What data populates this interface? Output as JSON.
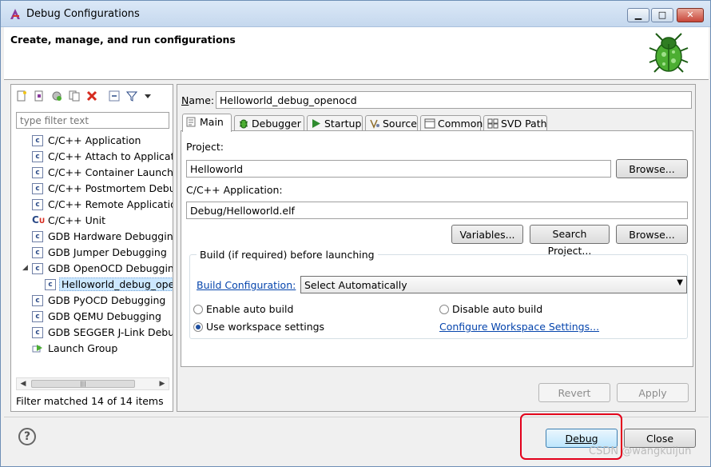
{
  "window": {
    "title": "Debug Configurations",
    "controls": {
      "minimize": "▁",
      "maximize": "□",
      "close": "✕"
    }
  },
  "banner": {
    "headline": "Create, manage, and run configurations"
  },
  "left_panel": {
    "filter_placeholder": "type filter text",
    "tree": [
      {
        "label": "C/C++ Application",
        "icon": "c-config-icon",
        "level": 1
      },
      {
        "label": "C/C++ Attach to Applicatio",
        "icon": "c-config-icon",
        "level": 1
      },
      {
        "label": "C/C++ Container Launche",
        "icon": "c-config-icon",
        "level": 1
      },
      {
        "label": "C/C++ Postmortem Debu",
        "icon": "c-config-icon",
        "level": 1
      },
      {
        "label": "C/C++ Remote Applicatio",
        "icon": "c-config-icon",
        "level": 1
      },
      {
        "label": "C/C++ Unit",
        "icon": "cu-icon",
        "level": 1
      },
      {
        "label": "GDB Hardware Debugging",
        "icon": "c-config-icon",
        "level": 1
      },
      {
        "label": "GDB Jumper Debugging",
        "icon": "c-config-icon",
        "level": 1
      },
      {
        "label": "GDB OpenOCD Debuggin",
        "icon": "c-config-icon",
        "level": 1,
        "expanded": true
      },
      {
        "label": "Helloworld_debug_ope",
        "icon": "c-config-icon",
        "level": 2,
        "selected": true
      },
      {
        "label": "GDB PyOCD Debugging",
        "icon": "c-config-icon",
        "level": 1
      },
      {
        "label": "GDB QEMU Debugging",
        "icon": "c-config-icon",
        "level": 1
      },
      {
        "label": "GDB SEGGER J-Link Debu",
        "icon": "c-config-icon",
        "level": 1
      },
      {
        "label": "Launch Group",
        "icon": "launch-group-icon",
        "level": 1
      }
    ],
    "filter_status": "Filter matched 14 of 14 items"
  },
  "main": {
    "name_label": "Name:",
    "name_value": "Helloworld_debug_openocd",
    "tabs": [
      {
        "label": "Main",
        "icon": "main-tab-icon",
        "active": true
      },
      {
        "label": "Debugger",
        "icon": "bug-icon"
      },
      {
        "label": "Startup",
        "icon": "play-icon"
      },
      {
        "label": "Source",
        "icon": "source-icon"
      },
      {
        "label": "Common",
        "icon": "common-icon"
      },
      {
        "label": "SVD Path",
        "icon": "svd-icon"
      }
    ],
    "project_label": "Project:",
    "project_value": "Helloworld",
    "browse_label": "Browse...",
    "app_label": "C/C++ Application:",
    "app_value": "Debug/Helloworld.elf",
    "variables_label": "Variables...",
    "search_project_label": "Search Project...",
    "browse2_label": "Browse...",
    "build_group": {
      "title": "Build (if required) before launching",
      "config_link": "Build Configuration:",
      "config_value": "Select Automatically",
      "enable_auto": "Enable auto build",
      "disable_auto": "Disable auto build",
      "workspace_settings": "Use workspace settings",
      "configure_link": "Configure Workspace Settings...",
      "selected_option": "workspace_settings"
    },
    "revert_label": "Revert",
    "apply_label": "Apply"
  },
  "footer": {
    "help_label": "?",
    "debug_label": "Debug",
    "close_label": "Close",
    "watermark": "CSDN @wangkuijun"
  },
  "colors": {
    "highlight": "#e3001b",
    "link": "#0645ad",
    "selection": "#cce8ff"
  }
}
